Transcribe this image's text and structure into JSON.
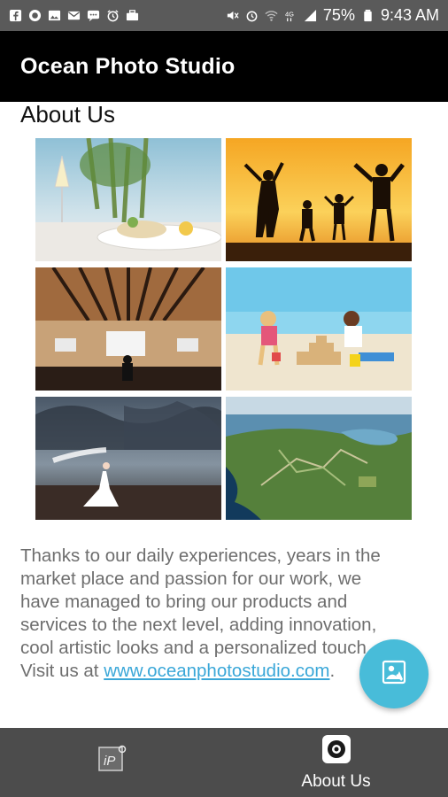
{
  "status_bar": {
    "battery_percent": "75%",
    "time": "9:43 AM",
    "network": "4G",
    "left_icons": [
      "facebook-icon",
      "messenger-icon",
      "gallery-icon",
      "mail-icon",
      "sms-icon",
      "alarm-icon",
      "briefcase-icon"
    ],
    "right_icons": [
      "mute-icon",
      "alarm-icon",
      "wifi-icon",
      "network-icon",
      "signal-icon",
      "battery-icon"
    ]
  },
  "app_bar": {
    "title": "Ocean Photo Studio"
  },
  "page": {
    "section_title": "About Us"
  },
  "gallery": [
    {
      "subject": "plated-food-with-wine"
    },
    {
      "subject": "family-silhouettes-at-sunset"
    },
    {
      "subject": "conference-hall-presentation"
    },
    {
      "subject": "children-building-sandcastle"
    },
    {
      "subject": "bride-on-beach"
    },
    {
      "subject": "aerial-coastline"
    }
  ],
  "about": {
    "text": "Thanks to our daily experiences, years in the market place and passion for our work, we have managed to bring our products and services to the next level, adding innovation, cool artistic looks and a personalized touch. Visit us at ",
    "link": "www.oceanphotostudio.com",
    "after": "."
  },
  "fab": {
    "icon": "contact-icon"
  },
  "bottom_nav": {
    "items": [
      {
        "label": "",
        "icon": "ip-logo-icon"
      },
      {
        "label": "About Us",
        "icon": "camera-lens-icon"
      }
    ]
  },
  "colors": {
    "status_bar": "#5a5a5a",
    "app_bar": "#000000",
    "link": "#3aa7d8",
    "fab": "#48bcd9",
    "bottom_nav": "#4c4c4c"
  }
}
